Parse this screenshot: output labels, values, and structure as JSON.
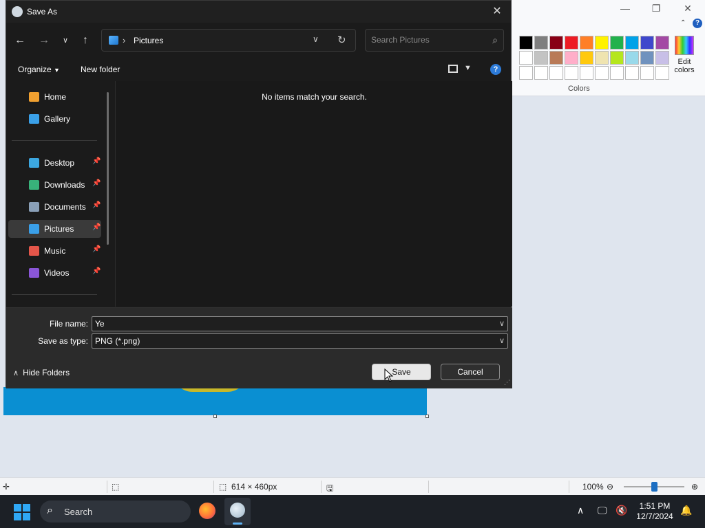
{
  "paint": {
    "palette_colors": [
      "#000000",
      "#7f7f7f",
      "#880015",
      "#ed1c24",
      "#ff7f27",
      "#fff200",
      "#22b14c",
      "#00a2e8",
      "#3f48cc",
      "#a349a4",
      "#ffffff",
      "#c3c3c3",
      "#b97a57",
      "#ffaec9",
      "#ffc90e",
      "#efe4b0",
      "#b5e61d",
      "#99d9ea",
      "#7092be",
      "#c8bfe7",
      "#ffffff",
      "#ffffff",
      "#ffffff",
      "#ffffff",
      "#ffffff",
      "#ffffff",
      "#ffffff",
      "#ffffff",
      "#ffffff",
      "#ffffff"
    ],
    "edit_colors_label_1": "Edit",
    "edit_colors_label_2": "colors",
    "colors_group_label": "Colors",
    "help_label": "?",
    "status": {
      "canvas_size": "614 × 460px",
      "zoom": "100%"
    }
  },
  "dialog": {
    "title": "Save As",
    "address": {
      "path": "Pictures",
      "separator": "›"
    },
    "search": {
      "placeholder": "Search Pictures"
    },
    "commands": {
      "organize": "Organize",
      "new_folder": "New folder",
      "help": "?"
    },
    "sidebar": {
      "items": [
        {
          "label": "Home",
          "icon": "home-icon",
          "color": "#f0a030",
          "pinned": false
        },
        {
          "label": "Gallery",
          "icon": "gallery-icon",
          "color": "#3aa0e8",
          "pinned": false
        },
        {
          "label": "Desktop",
          "icon": "desktop-icon",
          "color": "#3ca7e0",
          "pinned": true
        },
        {
          "label": "Downloads",
          "icon": "downloads-icon",
          "color": "#38b27a",
          "pinned": true
        },
        {
          "label": "Documents",
          "icon": "documents-icon",
          "color": "#8aa0b8",
          "pinned": true
        },
        {
          "label": "Pictures",
          "icon": "pictures-icon",
          "color": "#3a9fe8",
          "pinned": true
        },
        {
          "label": "Music",
          "icon": "music-icon",
          "color": "#e4564a",
          "pinned": true
        },
        {
          "label": "Videos",
          "icon": "videos-icon",
          "color": "#8a56d8",
          "pinned": true
        }
      ],
      "pin_glyph": "📌"
    },
    "content": {
      "empty_message": "No items match your search."
    },
    "form": {
      "file_name_label": "File name:",
      "file_name_value": "Ye",
      "save_type_label": "Save as type:",
      "save_type_value": "PNG (*.png)"
    },
    "hide_folders": "Hide Folders",
    "save_button": "Save",
    "cancel_button": "Cancel"
  },
  "taskbar": {
    "search_label": "Search",
    "time": "1:51 PM",
    "date": "12/7/2024"
  }
}
